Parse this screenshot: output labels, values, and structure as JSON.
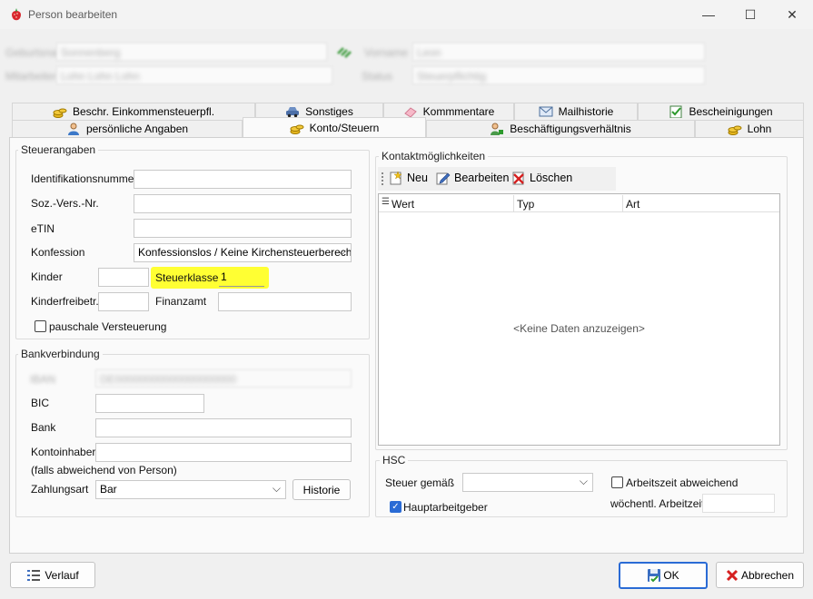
{
  "window": {
    "title": "Person bearbeiten",
    "minimize": "—",
    "maximize": "☐",
    "close": "✕"
  },
  "header": {
    "row1_label1": "Geburtsname",
    "row1_value1": "Sonnenberg",
    "row1_label2": "Vorname",
    "row1_value2": "Leon",
    "row2_label1": "Mitarbeiter",
    "row2_value1": "Lohn Lohn Lohn",
    "row2_label2": "Status",
    "row2_value2": "Steuerpflichtig"
  },
  "tabs": {
    "row_top": [
      "Beschr. Einkommensteuerpfl.",
      "Sonstiges",
      "Kommmentare",
      "Mailhistorie",
      "Bescheinigungen"
    ],
    "row_bottom": [
      "persönliche Angaben",
      "Konto/Steuern",
      "Beschäftigungsverhältnis",
      "Lohn"
    ]
  },
  "steuer": {
    "legend": "Steuerangaben",
    "id_label": "Identifikationsnummer",
    "id_value": "",
    "sv_label": "Soz.-Vers.-Nr.",
    "sv_value": "",
    "etin_label": "eTIN",
    "etin_value": "",
    "konfession_label": "Konfession",
    "konfession_value": "Konfessionslos / Keine Kirchensteuerberechnu",
    "kinder_label": "Kinder",
    "kinder_value": "",
    "steuerklasse_label": "Steuerklasse",
    "steuerklasse_value": "1",
    "kinderfreibetr_label": "Kinderfreibetr.",
    "kinderfreibetr_value": "",
    "finanzamt_label": "Finanzamt",
    "finanzamt_value": "",
    "pauschal_label": "pauschale Versteuerung",
    "pauschal_checked": false
  },
  "bank": {
    "legend": "Bankverbindung",
    "iban_label": "IBAN",
    "iban_value": "DE00000000000000000000",
    "bic_label": "BIC",
    "bic_value": "",
    "bank_label": "Bank",
    "bank_value": "",
    "inhaber_label": "Kontoinhaber",
    "inhaber_value": "",
    "inhaber_note": "(falls abweichend von Person)",
    "zahlungsart_label": "Zahlungsart",
    "zahlungsart_value": "Bar",
    "historie_button": "Historie"
  },
  "kontakt": {
    "legend": "Kontaktmöglichkeiten",
    "new_button": "Neu",
    "edit_button": "Bearbeiten",
    "delete_button": "Löschen",
    "columns": [
      "Wert",
      "Typ",
      "Art"
    ],
    "empty_text": "<Keine Daten anzuzeigen>"
  },
  "hsc": {
    "legend": "HSC",
    "steuer_label": "Steuer gemäß",
    "steuer_value": "",
    "arbeitszeit_label": "Arbeitszeit abweichend",
    "arbeitszeit_checked": false,
    "haupt_label": "Hauptarbeitgeber",
    "haupt_checked": true,
    "woechentl_label": "wöchentl. Arbeitzeit",
    "woechentl_value": ""
  },
  "footer": {
    "verlauf_button": "Verlauf",
    "ok_button": "OK",
    "abbrechen_button": "Abbrechen"
  },
  "colors": {
    "highlight": "#ffff33",
    "accent": "#2a6bd5"
  }
}
